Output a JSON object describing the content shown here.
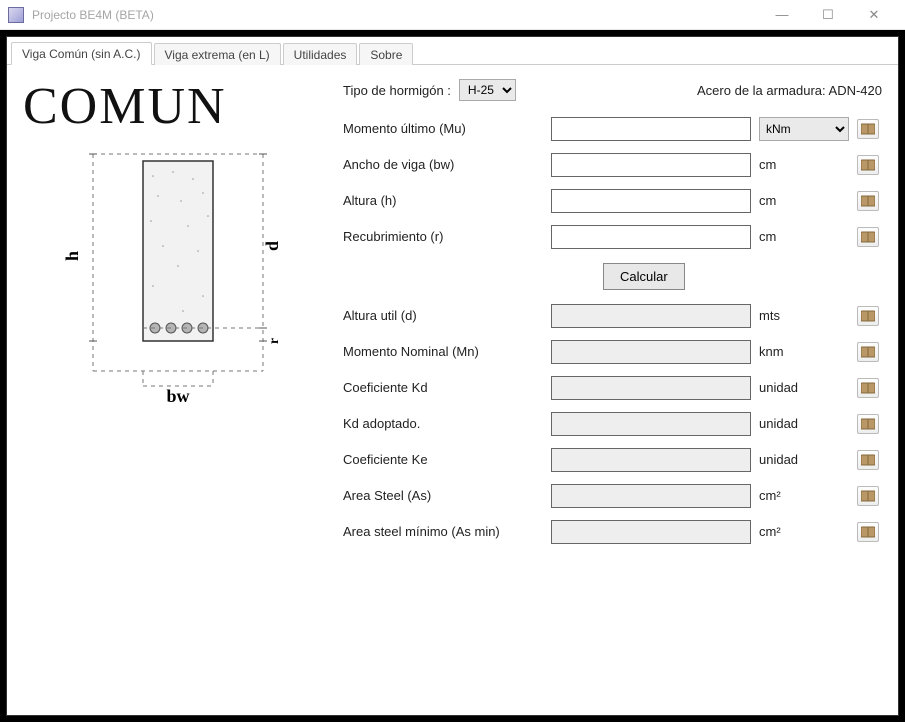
{
  "window": {
    "title": "Projecto BE4M  (BETA)"
  },
  "tabs": [
    {
      "label": "Viga Común (sin A.C.)",
      "active": true
    },
    {
      "label": "Viga extrema (en L)"
    },
    {
      "label": "Utilidades"
    },
    {
      "label": "Sobre"
    }
  ],
  "heading": "COMUN",
  "top": {
    "concrete_label": "Tipo de hormigón :",
    "concrete_value": "H-25",
    "steel_label": "Acero de la armadura: ADN-420"
  },
  "calc_button": "Calcular",
  "inputs": [
    {
      "label": "Momento último (Mu)",
      "unit_select": "kNm",
      "editable": true,
      "has_unit_select": true
    },
    {
      "label": "Ancho de viga (bw)",
      "unit": "cm",
      "editable": true
    },
    {
      "label": "Altura (h)",
      "unit": "cm",
      "editable": true
    },
    {
      "label": "Recubrimiento (r)",
      "unit": "cm",
      "editable": true
    }
  ],
  "outputs": [
    {
      "label": "Altura util (d)",
      "unit": "mts"
    },
    {
      "label": "Momento Nominal (Mn)",
      "unit": "knm"
    },
    {
      "label": "Coeficiente Kd",
      "unit": "unidad"
    },
    {
      "label": "Kd adoptado.",
      "unit": "unidad"
    },
    {
      "label": "Coeficiente Ke",
      "unit": "unidad"
    },
    {
      "label": "Area Steel (As)",
      "unit": "cm²"
    },
    {
      "label": "Area steel mínimo (As min)",
      "unit": "cm²"
    }
  ],
  "diagram": {
    "h": "h",
    "d": "d",
    "r": "r",
    "bw": "bw"
  }
}
